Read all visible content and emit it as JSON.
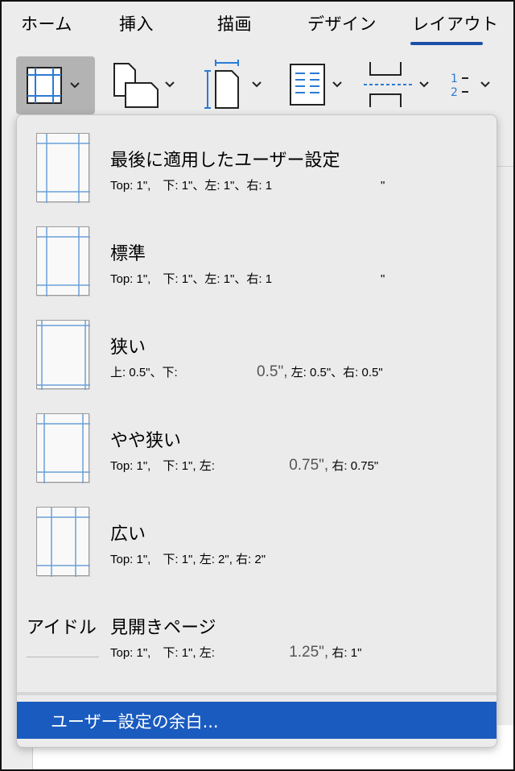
{
  "tabs": [
    "ホーム",
    "挿入",
    "描画",
    "デザイン",
    "レイアウト"
  ],
  "active_tab": "レイアウト",
  "accent_color": "#1c4fa8",
  "selection_color": "#1a5bbf",
  "toolbar": {
    "icons": [
      "margins-icon",
      "orientation-icon",
      "size-icon",
      "columns-icon",
      "breaks-icon",
      "line-numbers-icon"
    ]
  },
  "margins_menu": {
    "items": [
      {
        "title": "最後に適用したユーザー設定",
        "desc": "Top: 1\",　下: 1\"、左: 1\"、右: 1　　　　　　　　　\""
      },
      {
        "title": "標準",
        "desc": "Top: 1\",　下: 1\"、左: 1\"、右: 1　　　　　　　　　\""
      },
      {
        "title": "狭い",
        "desc_a": "上: 0.5\"、下:",
        "desc_big": "0.5\",",
        "desc_b": "左: 0.5\"、右: 0.5\""
      },
      {
        "title": "やや狭い",
        "desc_a": "Top: 1\",　下: 1\", 左:",
        "desc_big": "0.75\",",
        "desc_b": "右: 0.75\""
      },
      {
        "title": "広い",
        "desc": "Top: 1\",　下: 1\", 左: 2\", 右: 2\""
      },
      {
        "title": "見開きページ",
        "thumb_label": "アイドル",
        "desc_a": "Top: 1\",　下: 1\", 左:",
        "desc_big": "1.25\",",
        "desc_b": "右: 1\""
      }
    ],
    "custom_label": "ユーザー設定の余白..."
  }
}
